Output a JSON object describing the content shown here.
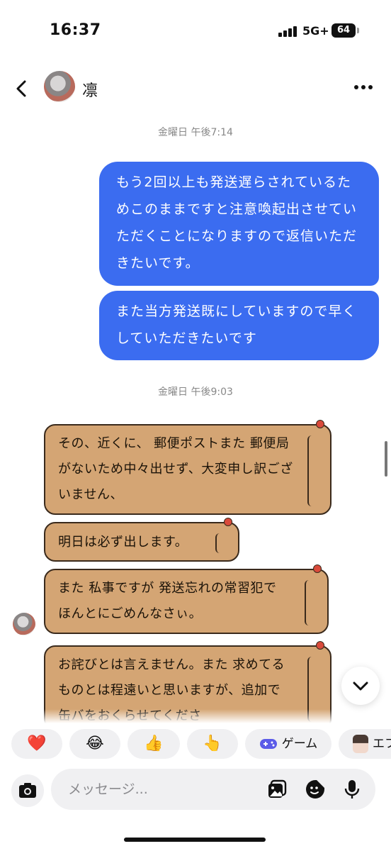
{
  "status_bar": {
    "time": "16:37",
    "network": "5G+",
    "battery": "64"
  },
  "header": {
    "contact_name": "凛",
    "back_icon": "chevron-left-icon",
    "more_icon": "more-horizontal-icon"
  },
  "messages": {
    "ts1": "金曜日 午後7:14",
    "sent": [
      "もう2回以上も発送遅らされているためこのままですと注意喚起出させていただくことになりますので返信いただきたいです。",
      "また当方発送既にしていますので早くしていただきたいです"
    ],
    "ts2": "金曜日 午後9:03",
    "received": [
      "その、近くに、 郵便ポストまた 郵便局がないため中々出せず、大変申し訳ございません、",
      "明日は必ず出します。",
      "また 私事ですが 発送忘れの常習犯で ほんとにごめんなさぃ。",
      "お詫びとは言えません。また 求めてるものとは程遠いと思いますが、追加で 缶バをおくらせてくださ"
    ]
  },
  "reactions": {
    "heart": "❤️",
    "laugh": "😂",
    "thumbs": "👍",
    "point": "👆",
    "game_label": "ゲーム",
    "effect_label": "エフ"
  },
  "composer": {
    "placeholder": "メッセージ..."
  },
  "colors": {
    "sent_bubble": "#3b6cf0",
    "received_bubble": "#d4a574",
    "chip_bg": "#f0f0f2"
  }
}
